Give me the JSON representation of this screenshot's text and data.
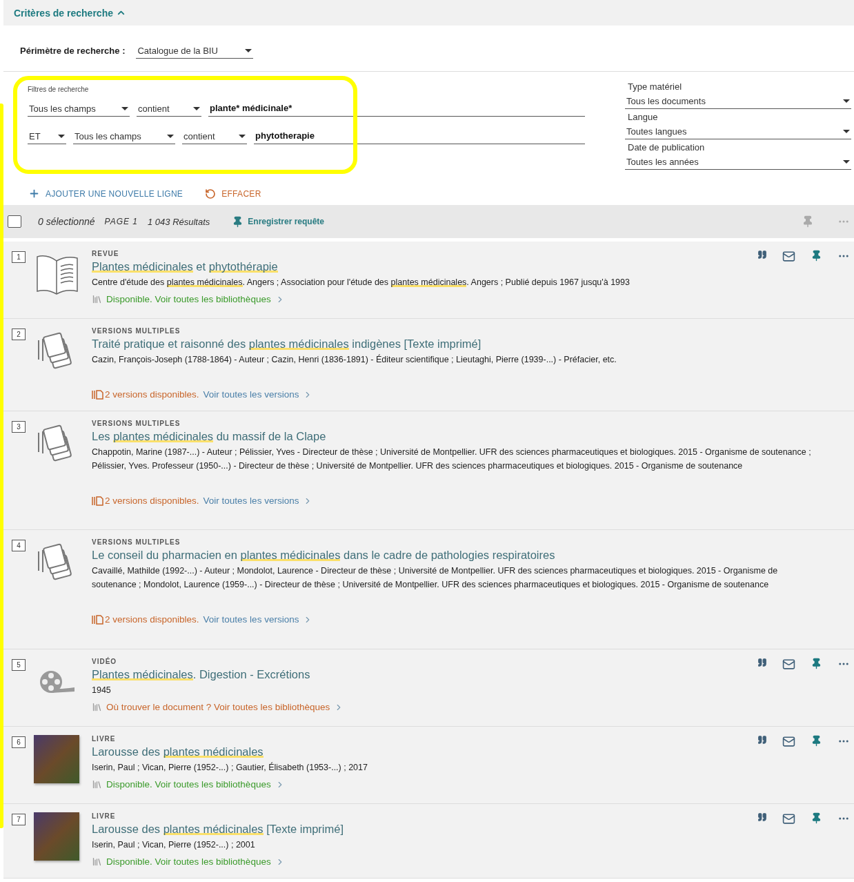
{
  "criteria_header": {
    "label": "Critères de recherche",
    "expanded": true
  },
  "scope": {
    "label": "Périmètre de recherche :",
    "value": "Catalogue de la BIU"
  },
  "filters": {
    "legend": "Filtres de recherche",
    "rows": [
      {
        "field": "Tous les champs",
        "condition": "contient",
        "query": "plante* médicinale*"
      },
      {
        "operator": "ET",
        "field": "Tous les champs",
        "condition": "contient",
        "query": "phytotherapie"
      }
    ]
  },
  "facets": [
    {
      "label": "Type matériel",
      "value": "Tous les documents"
    },
    {
      "label": "Langue",
      "value": "Toutes langues"
    },
    {
      "label": "Date de publication",
      "value": "Toutes les années"
    }
  ],
  "line_actions": {
    "add_line": "AJOUTER UNE NOUVELLE LIGNE",
    "clear": "EFFACER"
  },
  "toolbar": {
    "select_all_checked": false,
    "selected_count": "0 sélectionné",
    "page": "PAGE 1",
    "results": "1 043 Résultats",
    "save_query": "Enregistrer requête"
  },
  "results": [
    {
      "number": "1",
      "type": "REVUE",
      "thumbnail": {
        "kind": "book"
      },
      "title": [
        {
          "text": "Plantes médicinales",
          "highlight": true
        },
        {
          "text": " et ",
          "highlight": false
        },
        {
          "text": "phytothérapie",
          "highlight": true
        }
      ],
      "details": [
        {
          "text": "Centre d'étude des ",
          "highlight": false
        },
        {
          "text": "plantes médicinales",
          "highlight": true
        },
        {
          "text": ". Angers ; Association pour l'étude des ",
          "highlight": false
        },
        {
          "text": "plantes médicinales",
          "highlight": true
        },
        {
          "text": ". Angers ; Publié depuis 1967 jusqu'à 1993",
          "highlight": false
        }
      ],
      "availability": {
        "kind": "available",
        "status": "Disponible. Voir toutes les bibliothèques"
      },
      "actions_shown": true
    },
    {
      "number": "2",
      "type": "VERSIONS MULTIPLES",
      "thumbnail": {
        "kind": "versions"
      },
      "title": [
        {
          "text": "Traité pratique et raisonné des ",
          "highlight": false
        },
        {
          "text": "plantes médicinales",
          "highlight": true
        },
        {
          "text": " indigènes [Texte imprimé]",
          "highlight": false
        }
      ],
      "details": [
        {
          "text": "Cazin, François-Joseph (1788-1864) - Auteur ; Cazin, Henri (1836-1891) - Éditeur scientifique ; Lieutaghi, Pierre (1939-...) - Préfacier, etc.",
          "highlight": false
        }
      ],
      "availability": {
        "kind": "versions",
        "status": "2 versions disponibles.",
        "link": "Voir toutes les versions"
      },
      "actions_shown": false
    },
    {
      "number": "3",
      "type": "VERSIONS MULTIPLES",
      "thumbnail": {
        "kind": "versions"
      },
      "title": [
        {
          "text": "Les ",
          "highlight": false
        },
        {
          "text": "plantes médicinales",
          "highlight": true
        },
        {
          "text": " du massif de la Clape",
          "highlight": false
        }
      ],
      "details": [
        {
          "text": "Chappotin, Marine (1987-...) - Auteur ; Pélissier, Yves - Directeur de thèse ; Université de Montpellier. UFR des sciences pharmaceutiques et biologiques. 2015 - Organisme de soutenance ; Pélissier, Yves. Professeur (1950-...) - Directeur de thèse ; Université de Montpellier. UFR des sciences pharmaceutiques et biologiques. 2015 - Organisme de soutenance",
          "highlight": false
        }
      ],
      "availability": {
        "kind": "versions",
        "status": "2 versions disponibles.",
        "link": "Voir toutes les versions"
      },
      "actions_shown": false
    },
    {
      "number": "4",
      "type": "VERSIONS MULTIPLES",
      "thumbnail": {
        "kind": "versions"
      },
      "title": [
        {
          "text": "Le conseil du pharmacien en ",
          "highlight": false
        },
        {
          "text": "plantes médicinales",
          "highlight": true
        },
        {
          "text": " dans le cadre de pathologies respiratoires",
          "highlight": false
        }
      ],
      "details": [
        {
          "text": "Cavaillé, Mathilde (1992-...) - Auteur ; Mondolot, Laurence - Directeur de thèse ; Université de Montpellier. UFR des sciences pharmaceutiques et biologiques. 2015 - Organisme de soutenance ; Mondolot, Laurence (1959-...) - Directeur de thèse ; Université de Montpellier. UFR des sciences pharmaceutiques et biologiques. 2015 - Organisme de soutenance",
          "highlight": false
        }
      ],
      "availability": {
        "kind": "versions",
        "status": "2 versions disponibles.",
        "link": "Voir toutes les versions"
      },
      "actions_shown": false
    },
    {
      "number": "5",
      "type": "VIDÉO",
      "thumbnail": {
        "kind": "film"
      },
      "title": [
        {
          "text": "Plantes médicinales",
          "highlight": true
        },
        {
          "text": ". Digestion - Excrétions",
          "highlight": false
        }
      ],
      "details": [
        {
          "text": "1945",
          "highlight": false
        }
      ],
      "availability": {
        "kind": "where",
        "status": "Où trouver le document ? Voir toutes les bibliothèques"
      },
      "actions_shown": true
    },
    {
      "number": "6",
      "type": "LIVRE",
      "thumbnail": {
        "kind": "cover"
      },
      "title": [
        {
          "text": "Larousse des ",
          "highlight": false
        },
        {
          "text": "plantes médicinales",
          "highlight": true
        }
      ],
      "details": [
        {
          "text": "Iserin, Paul ; Vican, Pierre (1952-...) ; Gautier, Élisabeth (1953-...) ; 2017",
          "highlight": false
        }
      ],
      "availability": {
        "kind": "available",
        "status": "Disponible. Voir toutes les bibliothèques"
      },
      "actions_shown": true
    },
    {
      "number": "7",
      "type": "LIVRE",
      "thumbnail": {
        "kind": "cover"
      },
      "title": [
        {
          "text": "Larousse des ",
          "highlight": false
        },
        {
          "text": "plantes médicinales",
          "highlight": true
        },
        {
          "text": " [Texte imprimé]",
          "highlight": false
        }
      ],
      "details": [
        {
          "text": "Iserin, Paul ; Vican, Pierre (1952-...) ; 2001",
          "highlight": false
        }
      ],
      "availability": {
        "kind": "available",
        "status": "Disponible. Voir toutes les bibliothèques"
      },
      "actions_shown": true
    }
  ]
}
